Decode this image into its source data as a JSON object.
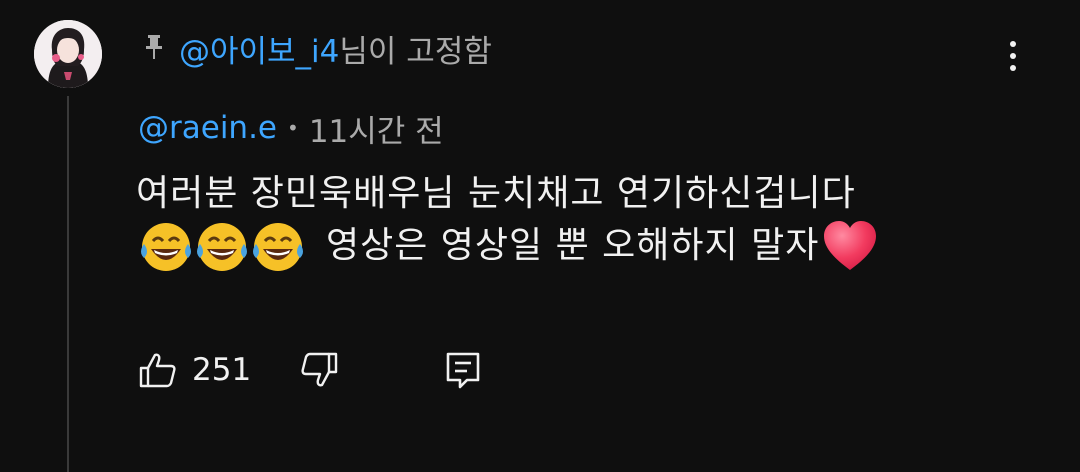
{
  "comment": {
    "pinned": {
      "handle": "@아이보_i4",
      "suffix": "님이 고정함"
    },
    "author": "@raein.e",
    "separator": "•",
    "timestamp": "11시간 전",
    "text_line1": "여러분 장민욱배우님 눈치채고 연기하신겁니다",
    "text_line2": "영상은 영상일 뿐 오해하지 말자",
    "emojis": [
      "face-with-tears-of-joy",
      "face-with-tears-of-joy",
      "face-with-tears-of-joy"
    ],
    "trailing_emoji": "heart",
    "like_count": "251",
    "colors": {
      "background": "#0f0f0f",
      "handle": "#3ea6ff",
      "muted": "#aaaaaa",
      "text": "#f1f1f1"
    }
  }
}
